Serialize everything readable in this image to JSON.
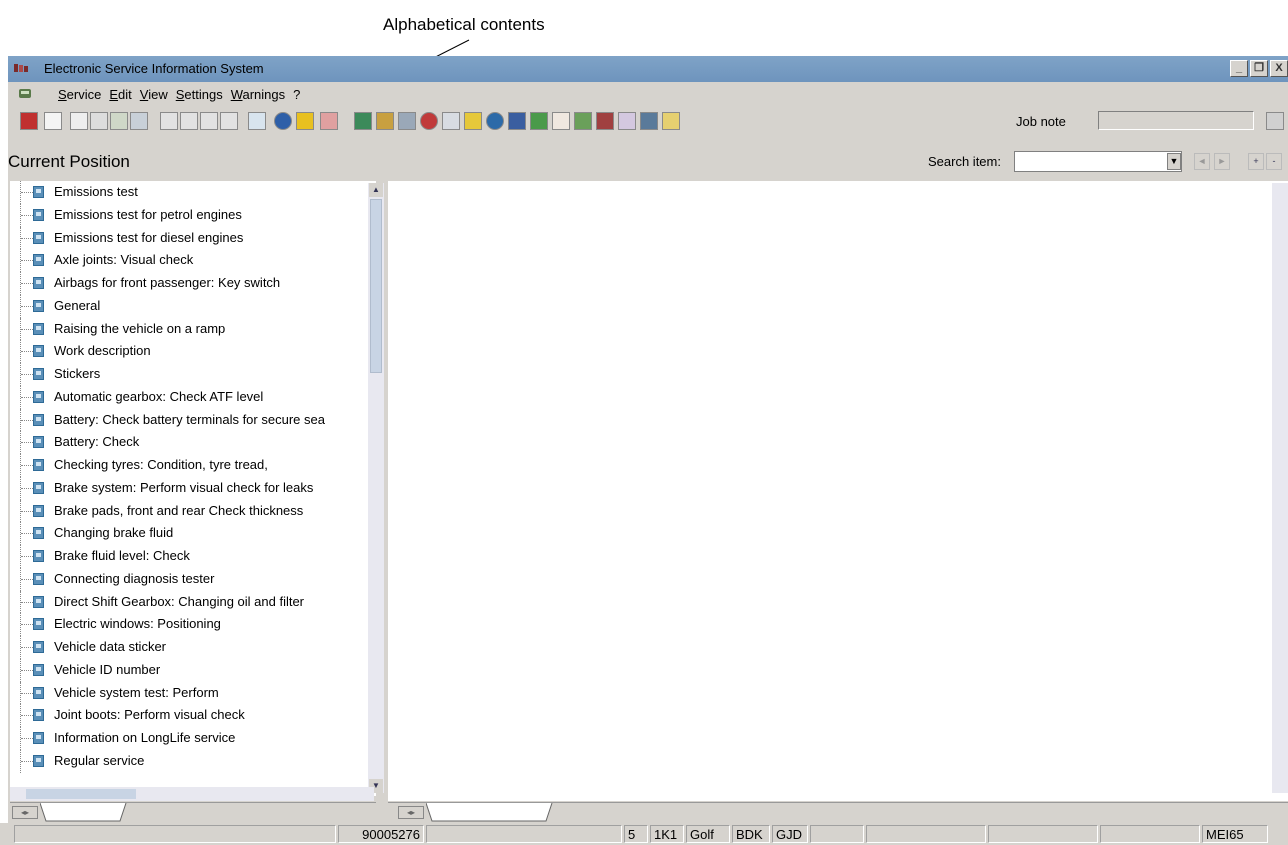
{
  "callout": {
    "text": "Alphabetical contents"
  },
  "window": {
    "title": "Electronic Service Information System",
    "controls": [
      "_",
      "❐",
      "X"
    ]
  },
  "menubar": {
    "items": [
      "Service",
      "Edit",
      "View",
      "Settings",
      "Warnings",
      "?"
    ]
  },
  "toolbar": {
    "job_note_label": "Job note",
    "job_note_value": ""
  },
  "position_bar": {
    "title": "Current Position",
    "search_label": "Search item:",
    "search_value": ""
  },
  "tree": {
    "items": [
      "Emissions test",
      "Emissions test for petrol engines",
      "Emissions test for diesel engines",
      "Axle joints: Visual check",
      "Airbags for front passenger: Key switch",
      "General",
      "Raising the vehicle on a ramp",
      "Work description",
      "Stickers",
      "Automatic gearbox: Check ATF level",
      "Battery: Check battery terminals for secure sea",
      "Battery: Check",
      "Checking tyres: Condition, tyre tread,",
      "Brake system: Perform visual check for leaks",
      "Brake pads, front and rear Check thickness",
      "Changing brake fluid",
      "Brake fluid level: Check",
      "Connecting diagnosis tester",
      "Direct Shift Gearbox: Changing oil and filter",
      "Electric windows: Positioning",
      "Vehicle data sticker",
      "Vehicle ID number",
      "Vehicle system test: Perform",
      "Joint boots: Perform visual check",
      "Information on LongLife service",
      "Regular service"
    ]
  },
  "statusbar": {
    "order_number": "90005276",
    "vehicle": [
      "5",
      "1K1",
      "Golf",
      "BDK",
      "GJD"
    ],
    "user": "MEI65"
  },
  "icons": {
    "tree_item": "document-icon",
    "app": "esis-logo-icon"
  }
}
